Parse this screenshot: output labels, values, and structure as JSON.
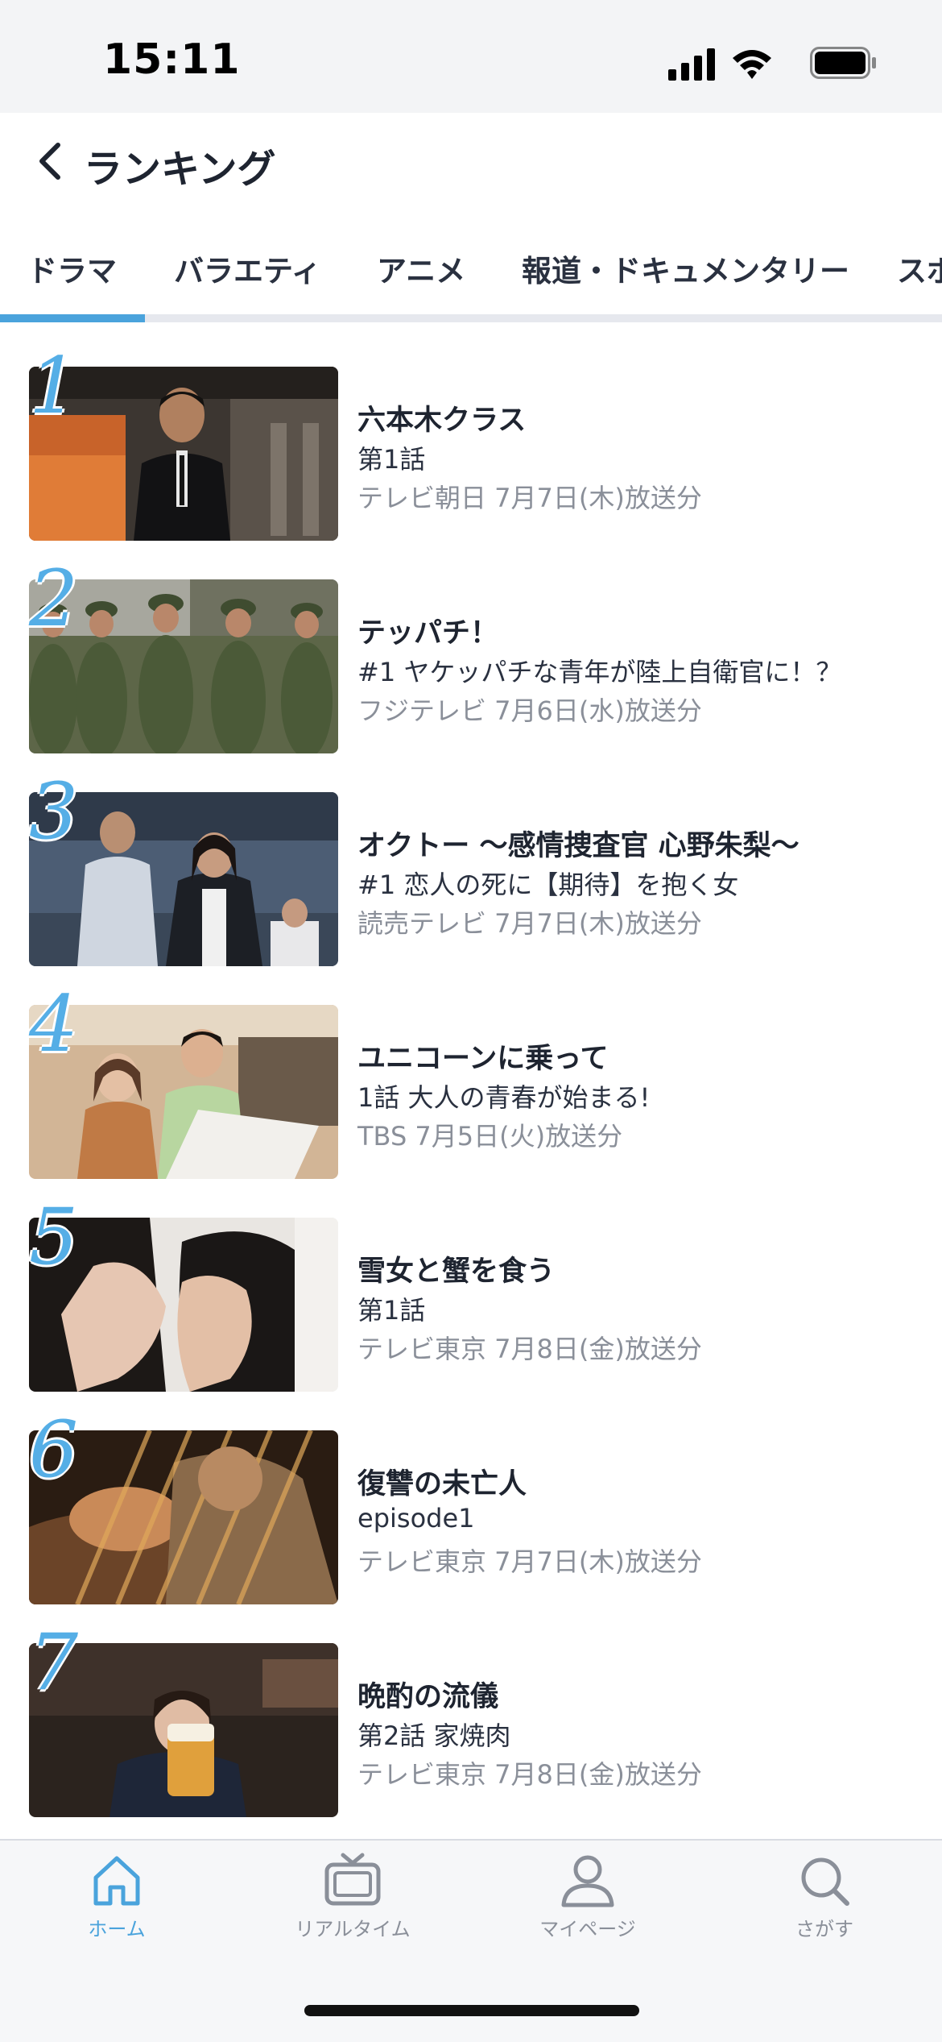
{
  "status_bar": {
    "time": "15:11"
  },
  "header": {
    "title": "ランキング"
  },
  "tabs": [
    {
      "label": "ドラマ",
      "active": true
    },
    {
      "label": "バラエティ",
      "active": false
    },
    {
      "label": "アニメ",
      "active": false
    },
    {
      "label": "報道・ドキュメンタリー",
      "active": false
    },
    {
      "label": "スポ",
      "active": false
    }
  ],
  "ranking": [
    {
      "rank": "1",
      "title": "六本木クラス",
      "episode": "第1話",
      "broadcast": "テレビ朝日 7月7日(木)放送分"
    },
    {
      "rank": "2",
      "title": "テッパチ！",
      "episode": "#1 ヤケッパチな青年が陸上自衛官に！？",
      "broadcast": "フジテレビ 7月6日(水)放送分"
    },
    {
      "rank": "3",
      "title": "オクトー 〜感情捜査官 心野朱梨〜",
      "episode": "#1  恋人の死に【期待】を抱く女",
      "broadcast": "読売テレビ 7月7日(木)放送分"
    },
    {
      "rank": "4",
      "title": "ユニコーンに乗って",
      "episode": "1話 大人の青春が始まる!",
      "broadcast": "TBS 7月5日(火)放送分"
    },
    {
      "rank": "5",
      "title": "雪女と蟹を食う",
      "episode": "第1話",
      "broadcast": "テレビ東京 7月8日(金)放送分"
    },
    {
      "rank": "6",
      "title": "復讐の未亡人",
      "episode": "episode1",
      "broadcast": "テレビ東京 7月7日(木)放送分"
    },
    {
      "rank": "7",
      "title": "晩酌の流儀",
      "episode": "第2話 家焼肉",
      "broadcast": "テレビ東京 7月8日(金)放送分"
    }
  ],
  "bottom_nav": [
    {
      "label": "ホーム",
      "icon": "home-icon",
      "active": true
    },
    {
      "label": "リアルタイム",
      "icon": "tv-icon",
      "active": false
    },
    {
      "label": "マイページ",
      "icon": "person-icon",
      "active": false
    },
    {
      "label": "さがす",
      "icon": "search-icon",
      "active": false
    }
  ],
  "colors": {
    "accent": "#4aa3dc",
    "rank_number": "#55aee6",
    "muted_text": "#8a8f99"
  }
}
